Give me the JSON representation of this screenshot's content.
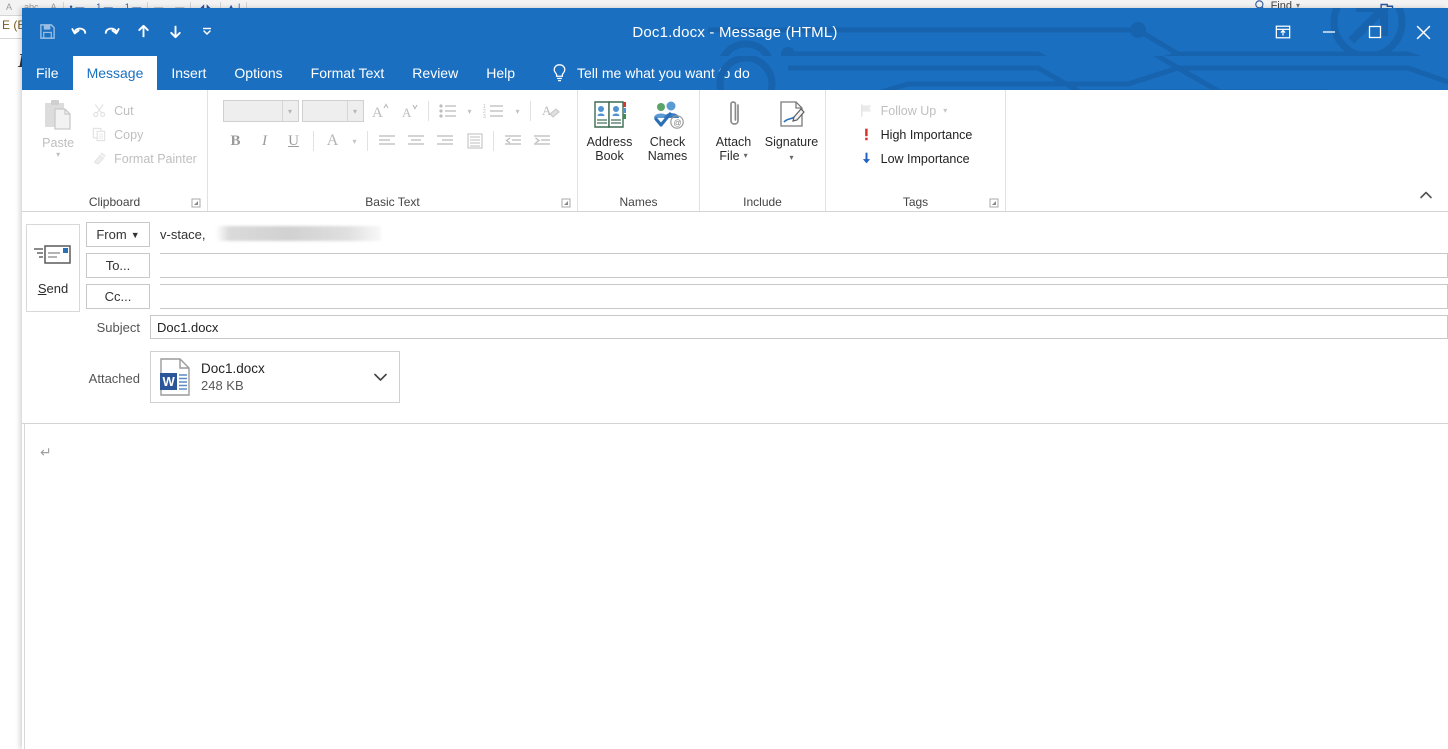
{
  "background_window": {
    "left_edge_text": "E (B",
    "left_edge_italic": "I",
    "find_label": "Find",
    "find_icon": "search-icon",
    "ribbon_glyphs": [
      "A",
      "abc",
      "A",
      "• —",
      "1 —",
      "1 —",
      "—",
      "—",
      "◢ ◣",
      "▲ |",
      "."
    ]
  },
  "titlebar": {
    "title": "Doc1.docx  -  Message (HTML)",
    "accent_color": "#1a6fc0",
    "quick_access": [
      {
        "name": "save-button",
        "icon": "save-icon",
        "enabled": false
      },
      {
        "name": "undo-button",
        "icon": "undo-icon",
        "enabled": true
      },
      {
        "name": "redo-button",
        "icon": "redo-icon",
        "enabled": true
      },
      {
        "name": "previous-item-button",
        "icon": "arrow-up-icon",
        "enabled": true
      },
      {
        "name": "next-item-button",
        "icon": "arrow-down-icon",
        "enabled": true
      },
      {
        "name": "customize-qat-button",
        "icon": "chevron-down-bar-icon",
        "enabled": true
      }
    ],
    "window_controls": [
      {
        "name": "ribbon-display-options-button",
        "icon": "ribbon-display-icon",
        "label": "Ribbon Display Options"
      },
      {
        "name": "minimize-button",
        "icon": "minimize-icon",
        "label": "Minimize"
      },
      {
        "name": "maximize-button",
        "icon": "maximize-icon",
        "label": "Maximize"
      },
      {
        "name": "close-button",
        "icon": "close-icon",
        "label": "Close"
      }
    ]
  },
  "tabs": [
    {
      "label": "File",
      "active": false
    },
    {
      "label": "Message",
      "active": true
    },
    {
      "label": "Insert",
      "active": false
    },
    {
      "label": "Options",
      "active": false
    },
    {
      "label": "Format Text",
      "active": false
    },
    {
      "label": "Review",
      "active": false
    },
    {
      "label": "Help",
      "active": false
    }
  ],
  "tell_me": {
    "icon": "lightbulb-icon",
    "label": "Tell me what you want to do"
  },
  "ribbon": {
    "collapse_icon": "chevron-up-icon",
    "groups": {
      "clipboard": {
        "label": "Clipboard",
        "paste_label": "Paste",
        "commands": [
          {
            "label": "Cut",
            "icon": "scissors-icon",
            "enabled": false
          },
          {
            "label": "Copy",
            "icon": "copy-icon",
            "enabled": false
          },
          {
            "label": "Format Painter",
            "icon": "format-painter-icon",
            "enabled": false
          }
        ]
      },
      "basic_text": {
        "label": "Basic Text",
        "font_name": "",
        "font_size": "",
        "buttons": [
          {
            "name": "grow-font-button",
            "label": "A"
          },
          {
            "name": "shrink-font-button",
            "label": "A"
          },
          {
            "name": "bullets-button",
            "label": ""
          },
          {
            "name": "numbering-button",
            "label": ""
          },
          {
            "name": "clear-formatting-button",
            "label": ""
          },
          {
            "name": "bold-button",
            "label": "B"
          },
          {
            "name": "italic-button",
            "label": "I"
          },
          {
            "name": "underline-button",
            "label": "U"
          },
          {
            "name": "font-color-button",
            "label": "A"
          },
          {
            "name": "align-left-button",
            "label": ""
          },
          {
            "name": "align-center-button",
            "label": ""
          },
          {
            "name": "align-right-button",
            "label": ""
          },
          {
            "name": "line-spacing-button",
            "label": ""
          },
          {
            "name": "decrease-indent-button",
            "label": ""
          },
          {
            "name": "increase-indent-button",
            "label": ""
          }
        ]
      },
      "names": {
        "label": "Names",
        "buttons": [
          {
            "name": "address-book-button",
            "line1": "Address",
            "line2": "Book",
            "icon": "address-book-icon"
          },
          {
            "name": "check-names-button",
            "line1": "Check",
            "line2": "Names",
            "icon": "check-names-icon"
          }
        ]
      },
      "include": {
        "label": "Include",
        "buttons": [
          {
            "name": "attach-file-button",
            "line1": "Attach",
            "line2": "File",
            "icon": "paperclip-icon",
            "has_dropdown": true
          },
          {
            "name": "signature-button",
            "line1": "Signature",
            "line2": "",
            "icon": "signature-icon",
            "has_dropdown": true
          }
        ]
      },
      "tags": {
        "label": "Tags",
        "commands": [
          {
            "label": "Follow Up",
            "icon": "flag-icon",
            "enabled": false,
            "has_dropdown": true,
            "color": "#bfbfbf"
          },
          {
            "label": "High Importance",
            "icon": "exclamation-icon",
            "enabled": true,
            "color": "#d93025"
          },
          {
            "label": "Low Importance",
            "icon": "arrow-down-icon",
            "enabled": true,
            "color": "#2060c0"
          }
        ]
      }
    }
  },
  "compose": {
    "send_label_pre": "S",
    "send_label_accel": "",
    "send_label_post": "end",
    "send_icon": "send-envelope-icon",
    "from": {
      "button_label": "From",
      "button_accel": "m",
      "dropdown_icon": "caret-down-icon",
      "value": "v-stace,",
      "redacted": true
    },
    "to": {
      "button_label": "To...",
      "button_accel": "o",
      "value": "",
      "placeholder": ""
    },
    "cc": {
      "button_label": "Cc...",
      "button_accel": "C",
      "value": "",
      "placeholder": ""
    },
    "subject": {
      "label": "Subject",
      "label_accel": "b",
      "value": "Doc1.docx"
    },
    "attached": {
      "label": "Attached",
      "label_accel": "A",
      "items": [
        {
          "name": "Doc1.docx",
          "size": "248 KB",
          "icon": "word-document-icon",
          "dropdown_icon": "chevron-down-icon"
        }
      ]
    },
    "body": {
      "text": "",
      "paragraph_mark": "↵"
    }
  }
}
